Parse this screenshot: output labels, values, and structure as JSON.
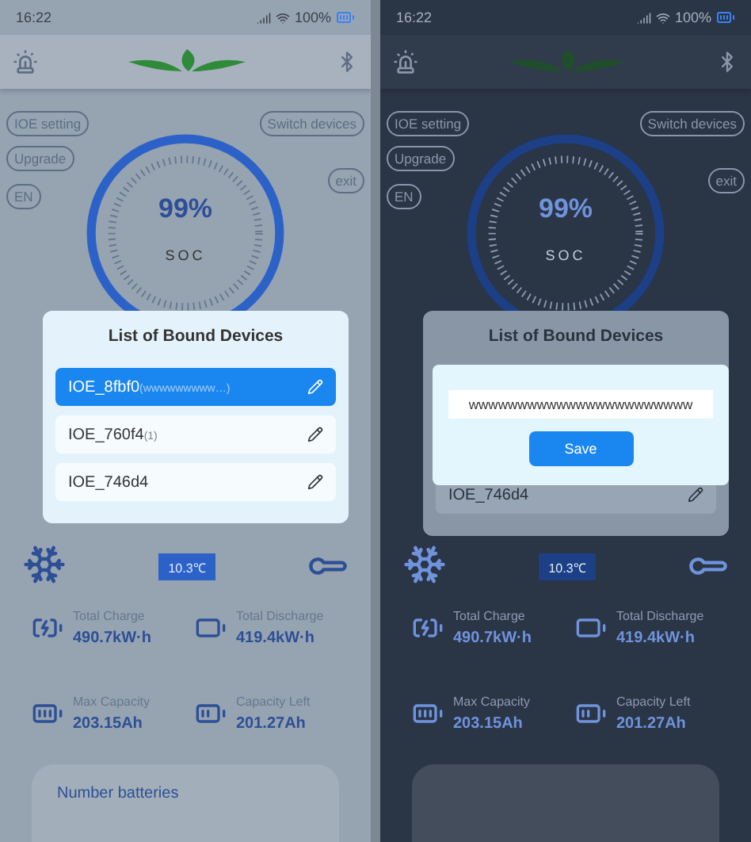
{
  "screens": [
    {
      "dark_backdrop": false,
      "status_bar": {
        "time": "16:22",
        "battery": "100%"
      },
      "left_buttons": [
        "IOE setting",
        "Upgrade",
        "EN"
      ],
      "right_buttons": [
        "Switch devices",
        "exit"
      ],
      "gauge": {
        "value": "99%",
        "label": "SOC"
      },
      "temperature": "10.3℃",
      "stats": [
        {
          "kind": "charge",
          "label": "Total Charge",
          "value": "490.7kW·h"
        },
        {
          "kind": "discharge",
          "label": "Total Discharge",
          "value": "419.4kW·h"
        },
        {
          "kind": "full",
          "label": "Max Capacity",
          "value": "203.15Ah"
        },
        {
          "kind": "half",
          "label": "Capacity Left",
          "value": "201.27Ah"
        }
      ],
      "footer_card": {
        "text": "Number batteries"
      },
      "dialog": {
        "title": "List of Bound Devices",
        "devices": [
          {
            "name": "IOE_8fbf0",
            "note": "(wwwwwwwww…)",
            "selected": true
          },
          {
            "name": "IOE_760f4",
            "note": "(1)",
            "selected": false
          },
          {
            "name": "IOE_746d4",
            "selected": false
          }
        ]
      }
    },
    {
      "dark_backdrop": true,
      "status_bar": {
        "time": "16:22",
        "battery": "100%"
      },
      "left_buttons": [
        "IOE setting",
        "Upgrade",
        "EN"
      ],
      "right_buttons": [
        "Switch devices",
        "exit"
      ],
      "gauge": {
        "value": "99%",
        "label": "SOC"
      },
      "temperature": "10.3℃",
      "stats": [
        {
          "kind": "charge",
          "label": "Total Charge",
          "value": "490.7kW·h"
        },
        {
          "kind": "discharge",
          "label": "Total Discharge",
          "value": "419.4kW·h"
        },
        {
          "kind": "full",
          "label": "Max Capacity",
          "value": "203.15Ah"
        },
        {
          "kind": "half",
          "label": "Capacity Left",
          "value": "201.27Ah"
        }
      ],
      "dialog": {
        "title": "List of Bound Devices",
        "devices": [
          {
            "name": "IOE_746d4",
            "selected": false
          }
        ]
      },
      "edit_dialog": {
        "value": "wwwwwwwwwwwwwwwwwwwwwww",
        "button": "Save"
      }
    }
  ]
}
